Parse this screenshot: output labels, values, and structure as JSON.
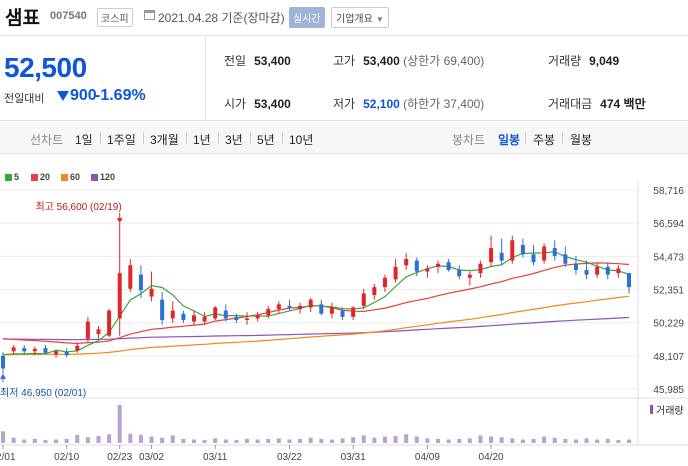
{
  "header": {
    "stock_name": "샘표",
    "stock_code": "007540",
    "market": "코스피",
    "date_text": "2021.04.28 기준(장마감)",
    "realtime_label": "실시간",
    "company_info_label": "기업개요"
  },
  "price": {
    "current": "52,500",
    "change_label": "전일대비",
    "change_value": "900",
    "change_pct": "-1.69%"
  },
  "stats": {
    "prev_close": {
      "label": "전일",
      "value": "53,400"
    },
    "high": {
      "label": "고가",
      "value": "53,400",
      "limit": "(상한가 69,400)"
    },
    "volume": {
      "label": "거래량",
      "value": "9,049"
    },
    "open": {
      "label": "시가",
      "value": "53,400"
    },
    "low": {
      "label": "저가",
      "value": "52,100",
      "limit": "(하한가 37,400)"
    },
    "trade_value": {
      "label": "거래대금",
      "value": "474",
      "unit": "백만"
    }
  },
  "periods": {
    "line_label": "선차트",
    "items": [
      "1일",
      "1주일",
      "3개월",
      "1년",
      "3년",
      "5년",
      "10년"
    ],
    "candle_label": "봉차트",
    "candle_items": [
      "일봉",
      "주봉",
      "월봉"
    ],
    "active_candle": "일봉"
  },
  "colors": {
    "up": "#e0262b",
    "down": "#2d6fd2",
    "ma5": "#38a838",
    "ma20": "#e8403a",
    "ma60": "#f08a16",
    "ma120": "#8e52b8",
    "volume": "#b5a4d0"
  },
  "legend": [
    {
      "label": "5",
      "color": "#38a838"
    },
    {
      "label": "20",
      "color": "#e8403a"
    },
    {
      "label": "60",
      "color": "#f08a16"
    },
    {
      "label": "120",
      "color": "#8e52b8"
    }
  ],
  "chart_data": {
    "type": "candlestick",
    "y_ticks": [
      "58,716",
      "56,594",
      "54,473",
      "52,351",
      "50,229",
      "48,107",
      "45,985"
    ],
    "ylim": [
      45985,
      58716
    ],
    "x_ticks": [
      "02/01",
      "02/10",
      "02/23",
      "03/02",
      "03/11",
      "03/22",
      "03/31",
      "04/09",
      "04/20"
    ],
    "x_tick_index": [
      0,
      6,
      11,
      14,
      20,
      27,
      33,
      40,
      46
    ],
    "max_label": "최고 56,600 (02/19)",
    "min_label": "최저 46,950 (02/01)",
    "volume_label": "거래량",
    "candles": [
      {
        "o": 48100,
        "h": 48350,
        "l": 46950,
        "c": 47300
      },
      {
        "o": 48400,
        "h": 48800,
        "l": 48200,
        "c": 48650
      },
      {
        "o": 48600,
        "h": 48800,
        "l": 48200,
        "c": 48400
      },
      {
        "o": 48400,
        "h": 48700,
        "l": 48150,
        "c": 48550
      },
      {
        "o": 48600,
        "h": 48800,
        "l": 48250,
        "c": 48300
      },
      {
        "o": 48200,
        "h": 48500,
        "l": 48000,
        "c": 48400
      },
      {
        "o": 48350,
        "h": 48600,
        "l": 48000,
        "c": 48150
      },
      {
        "o": 48450,
        "h": 48950,
        "l": 48300,
        "c": 48750
      },
      {
        "o": 49200,
        "h": 50600,
        "l": 49000,
        "c": 50300
      },
      {
        "o": 49500,
        "h": 50000,
        "l": 49200,
        "c": 49800
      },
      {
        "o": 49400,
        "h": 51100,
        "l": 49300,
        "c": 51000
      },
      {
        "o": 50500,
        "h": 56600,
        "l": 49400,
        "c": 53400
      },
      {
        "o": 52400,
        "h": 54300,
        "l": 52200,
        "c": 53900
      },
      {
        "o": 53300,
        "h": 53900,
        "l": 51800,
        "c": 52300
      },
      {
        "o": 51900,
        "h": 53500,
        "l": 51600,
        "c": 52400
      },
      {
        "o": 51700,
        "h": 52200,
        "l": 50100,
        "c": 50400
      },
      {
        "o": 50500,
        "h": 51600,
        "l": 50200,
        "c": 51000
      },
      {
        "o": 50800,
        "h": 51000,
        "l": 50200,
        "c": 50400
      },
      {
        "o": 50300,
        "h": 51000,
        "l": 50100,
        "c": 50700
      },
      {
        "o": 50300,
        "h": 50900,
        "l": 50100,
        "c": 50600
      },
      {
        "o": 50500,
        "h": 51300,
        "l": 50400,
        "c": 51200
      },
      {
        "o": 51000,
        "h": 51400,
        "l": 50300,
        "c": 50500
      },
      {
        "o": 50600,
        "h": 50800,
        "l": 50200,
        "c": 50400
      },
      {
        "o": 50400,
        "h": 50900,
        "l": 50100,
        "c": 50500
      },
      {
        "o": 50500,
        "h": 50900,
        "l": 50300,
        "c": 50700
      },
      {
        "o": 50700,
        "h": 51300,
        "l": 50500,
        "c": 51100
      },
      {
        "o": 51100,
        "h": 51600,
        "l": 50800,
        "c": 51400
      },
      {
        "o": 51300,
        "h": 51700,
        "l": 51000,
        "c": 51200
      },
      {
        "o": 51100,
        "h": 51500,
        "l": 50800,
        "c": 51300
      },
      {
        "o": 51200,
        "h": 51800,
        "l": 50900,
        "c": 51700
      },
      {
        "o": 51400,
        "h": 51700,
        "l": 50700,
        "c": 50800
      },
      {
        "o": 50800,
        "h": 51500,
        "l": 50500,
        "c": 51200
      },
      {
        "o": 51000,
        "h": 51200,
        "l": 50400,
        "c": 50600
      },
      {
        "o": 50600,
        "h": 51300,
        "l": 50400,
        "c": 51200
      },
      {
        "o": 51300,
        "h": 52400,
        "l": 51100,
        "c": 52100
      },
      {
        "o": 52000,
        "h": 52700,
        "l": 51700,
        "c": 52500
      },
      {
        "o": 52500,
        "h": 53300,
        "l": 52200,
        "c": 53100
      },
      {
        "o": 53000,
        "h": 54300,
        "l": 52800,
        "c": 53800
      },
      {
        "o": 53900,
        "h": 54700,
        "l": 53600,
        "c": 54300
      },
      {
        "o": 54200,
        "h": 54400,
        "l": 53200,
        "c": 53500
      },
      {
        "o": 53500,
        "h": 53900,
        "l": 53100,
        "c": 53700
      },
      {
        "o": 53800,
        "h": 54200,
        "l": 53400,
        "c": 54000
      },
      {
        "o": 54100,
        "h": 54300,
        "l": 53500,
        "c": 53600
      },
      {
        "o": 53600,
        "h": 53900,
        "l": 53000,
        "c": 53200
      },
      {
        "o": 53100,
        "h": 53500,
        "l": 52600,
        "c": 53300
      },
      {
        "o": 53400,
        "h": 54200,
        "l": 53100,
        "c": 54000
      },
      {
        "o": 54100,
        "h": 55800,
        "l": 53800,
        "c": 55000
      },
      {
        "o": 54700,
        "h": 55600,
        "l": 53900,
        "c": 54200
      },
      {
        "o": 54200,
        "h": 55800,
        "l": 54000,
        "c": 55500
      },
      {
        "o": 55200,
        "h": 55600,
        "l": 54400,
        "c": 54600
      },
      {
        "o": 54600,
        "h": 55200,
        "l": 53900,
        "c": 54100
      },
      {
        "o": 54200,
        "h": 55300,
        "l": 54000,
        "c": 55100
      },
      {
        "o": 55000,
        "h": 55500,
        "l": 54200,
        "c": 54500
      },
      {
        "o": 54600,
        "h": 55100,
        "l": 53800,
        "c": 54000
      },
      {
        "o": 54000,
        "h": 54500,
        "l": 53300,
        "c": 53600
      },
      {
        "o": 53600,
        "h": 54200,
        "l": 53000,
        "c": 53300
      },
      {
        "o": 53300,
        "h": 54000,
        "l": 53100,
        "c": 53800
      },
      {
        "o": 53800,
        "h": 54100,
        "l": 53000,
        "c": 53300
      },
      {
        "o": 53400,
        "h": 53900,
        "l": 53100,
        "c": 53700
      },
      {
        "o": 53400,
        "h": 53400,
        "l": 52100,
        "c": 52500
      }
    ],
    "volume": [
      40,
      18,
      12,
      14,
      10,
      12,
      14,
      28,
      20,
      24,
      30,
      130,
      32,
      28,
      22,
      18,
      26,
      14,
      12,
      10,
      16,
      12,
      10,
      14,
      12,
      14,
      16,
      12,
      14,
      18,
      14,
      12,
      16,
      20,
      26,
      18,
      22,
      24,
      30,
      22,
      16,
      14,
      12,
      14,
      16,
      26,
      22,
      20,
      16,
      12,
      14,
      22,
      18,
      14,
      12,
      16,
      12,
      14,
      10,
      12
    ],
    "volume_max": 130
  }
}
